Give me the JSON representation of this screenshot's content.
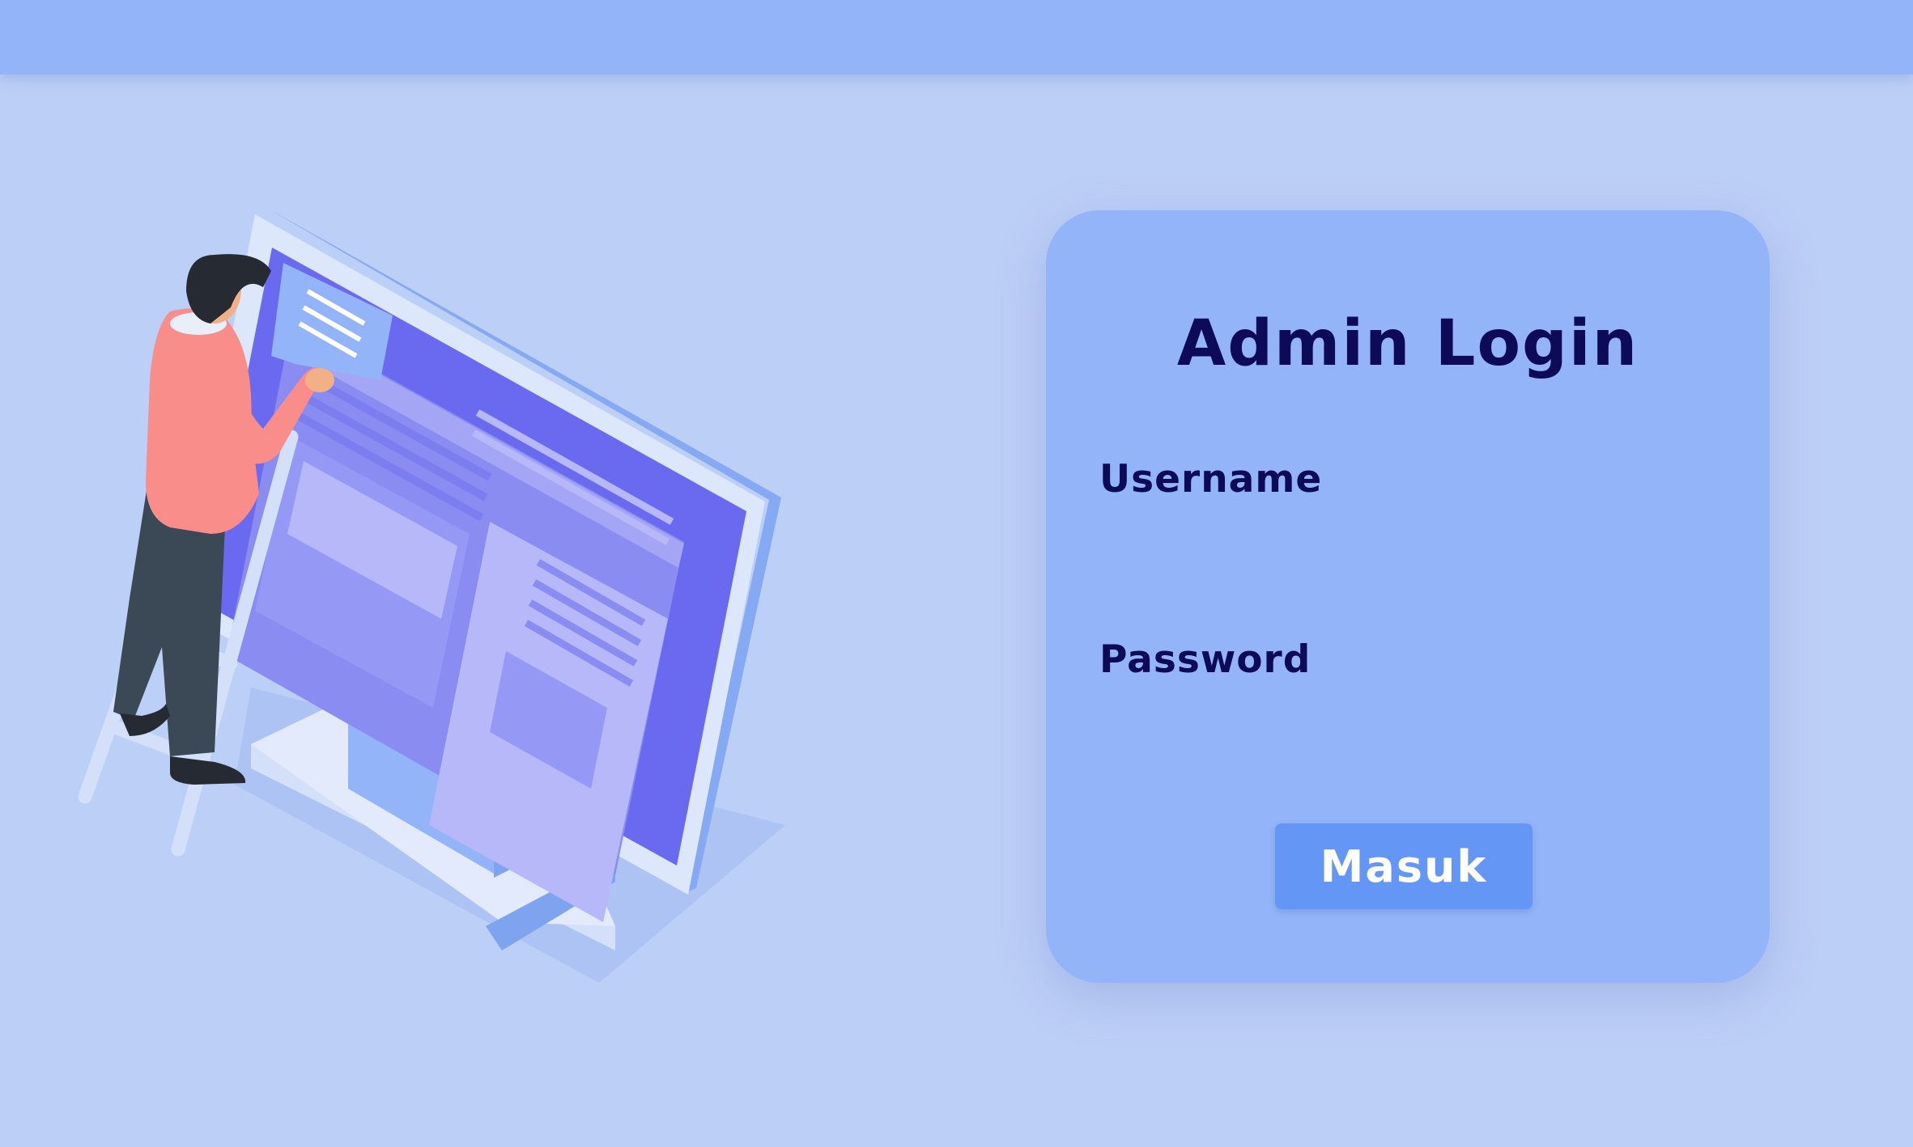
{
  "login": {
    "title": "Admin Login",
    "username_label": "Username",
    "username_value": "",
    "password_label": "Password",
    "password_value": "",
    "submit_label": "Masuk"
  },
  "colors": {
    "background": "#bccff6",
    "topbar": "#93b4f8",
    "card": "#93b4f8",
    "title_text": "#0d0a57",
    "button": "#6497f5",
    "button_text": "#ffffff"
  },
  "illustration": {
    "icon": "person-at-monitor-illustration"
  }
}
